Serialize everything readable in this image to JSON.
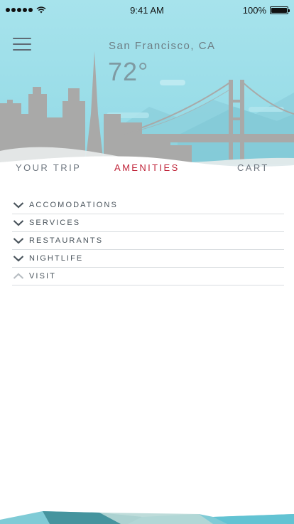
{
  "status_bar": {
    "time": "9:41 AM",
    "battery": "100%"
  },
  "header": {
    "city": "San Francisco, CA",
    "temperature": "72°"
  },
  "tabs": [
    {
      "label": "YOUR TRIP",
      "active": false
    },
    {
      "label": "AMENITIES",
      "active": true
    },
    {
      "label": "CART",
      "active": false
    }
  ],
  "amenities": [
    {
      "label": "ACCOMODATIONS",
      "icon": "chevron-down-icon",
      "expanded": false
    },
    {
      "label": "SERVICES",
      "icon": "chevron-down-icon",
      "expanded": false
    },
    {
      "label": "RESTAURANTS",
      "icon": "chevron-down-icon",
      "expanded": false
    },
    {
      "label": "NIGHTLIFE",
      "icon": "chevron-down-icon",
      "expanded": false
    },
    {
      "label": "VISIT",
      "icon": "chevron-up-icon",
      "expanded": true
    }
  ],
  "colors": {
    "accent": "#c0253a",
    "sky": "#9adde8",
    "skyline": "#a9a9a8",
    "text": "#4a545c"
  }
}
